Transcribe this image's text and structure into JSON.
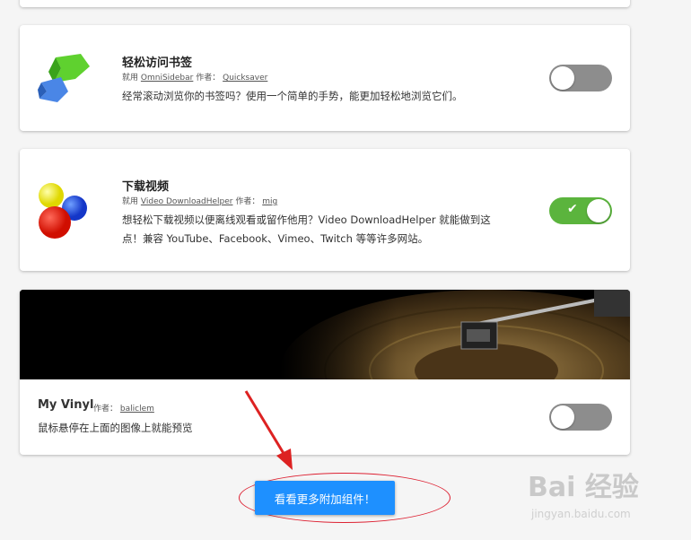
{
  "addons": [
    {
      "title": "轻松访问书签",
      "meta_prefix": "就用",
      "extension_name": "OmniSidebar",
      "author_label": "作者：",
      "author": "Quicksaver",
      "description": "经常滚动浏览你的书签吗？使用一个简单的手势，能更加轻松地浏览它们。",
      "enabled": false
    },
    {
      "title": "下载视频",
      "meta_prefix": "就用",
      "extension_name": "Video DownloadHelper",
      "author_label": "作者：",
      "author": "mig",
      "description_line1": "想轻松下载视频以便离线观看或留作他用？Video DownloadHelper 就能做到这",
      "description_line2": "点！兼容 YouTube、Facebook、Vimeo、Twitch 等等许多网站。",
      "enabled": true
    }
  ],
  "theme": {
    "title": "My Vinyl",
    "author_label": "作者：",
    "author": "baliclem",
    "description": "鼠标悬停在上面的图像上就能预览",
    "enabled": false
  },
  "more_button_label": "看看更多附加组件！",
  "watermark": {
    "text": "Bai 经验",
    "sub": "jingyan.baidu.com"
  },
  "colors": {
    "toggle_on": "#5bb43d",
    "toggle_off": "#8d8d8d",
    "button": "#1e90ff",
    "annotation": "#dd2222"
  }
}
